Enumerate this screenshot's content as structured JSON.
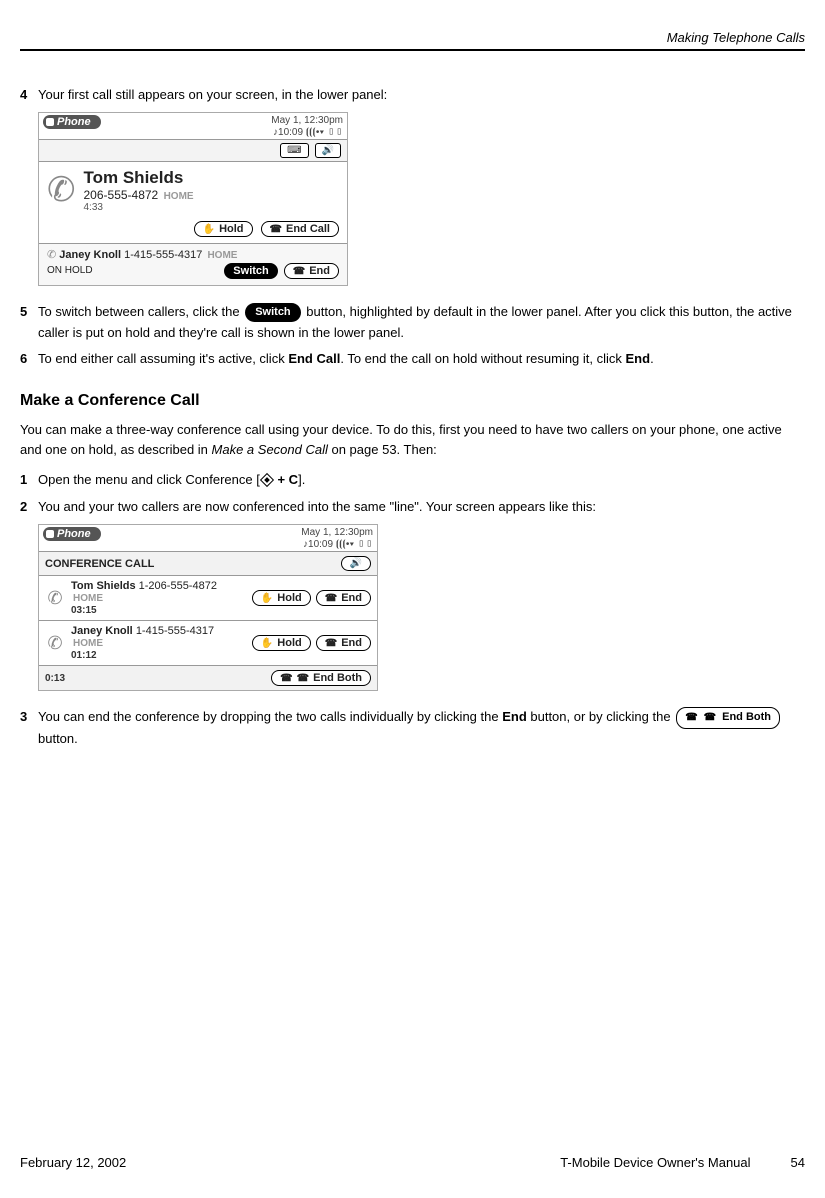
{
  "header": {
    "section_title": "Making Telephone Calls"
  },
  "steps_a": {
    "s4": {
      "num": "4",
      "text": "Your first call still appears on your screen, in the lower panel:"
    },
    "s5": {
      "num": "5",
      "pre": "To switch between callers, click the ",
      "switch_label": "Switch",
      "post": " button, highlighted by default in the lower panel. After you click this button, the active caller is put on hold and they're call is shown in the lower panel."
    },
    "s6": {
      "num": "6",
      "pre": "To end either call assuming it's active, click ",
      "b1": "End Call",
      "mid": ". To end the call on hold without resuming it, click ",
      "b2": "End",
      "post": "."
    }
  },
  "shot1": {
    "phone_label": "Phone",
    "date": "May 1, 12:30pm",
    "clock": "10:09",
    "active_name": "Tom Shields",
    "active_number": "206-555-4872",
    "active_tag": "HOME",
    "active_dur": "4:33",
    "hold_label": "Hold",
    "endcall_label": "End Call",
    "hold_name": "Janey Knoll",
    "hold_number": "1-415-555-4317",
    "hold_tag": "HOME",
    "onhold": "ON HOLD",
    "switch_label": "Switch",
    "end_label": "End"
  },
  "conf_section": {
    "heading": "Make a Conference Call",
    "intro_a": "You can make a three-way conference call using your device. To do this, first you need to have two callers on your phone, one active and one on hold, as described in ",
    "intro_ref": "Make a Second Call",
    "intro_b": " on page 53. Then:"
  },
  "steps_b": {
    "s1": {
      "num": "1",
      "pre": "Open the menu and click Conference [",
      "key": " + C",
      "post": "]."
    },
    "s2": {
      "num": "2",
      "text": "You and your two callers are now conferenced into the same \"line\". Your screen appears like this:"
    },
    "s3": {
      "num": "3",
      "pre": "You can end the conference by dropping the two calls individually by clicking the ",
      "b1": "End",
      "mid": " button, or by clicking the ",
      "endboth_label": "End Both",
      "post": " button."
    }
  },
  "shot2": {
    "phone_label": "Phone",
    "date": "May 1, 12:30pm",
    "clock": "10:09",
    "title": "CONFERENCE CALL",
    "c1_name": "Tom Shields",
    "c1_num": "1-206-555-4872",
    "c1_tag": "HOME",
    "c1_dur": "03:15",
    "c2_name": "Janey Knoll",
    "c2_num": "1-415-555-4317",
    "c2_tag": "HOME",
    "c2_dur": "01:12",
    "total_dur": "0:13",
    "hold_label": "Hold",
    "end_label": "End",
    "endboth_label": "End Both"
  },
  "footer": {
    "date": "February 12, 2002",
    "manual": "T-Mobile Device Owner's Manual",
    "page": "54"
  }
}
